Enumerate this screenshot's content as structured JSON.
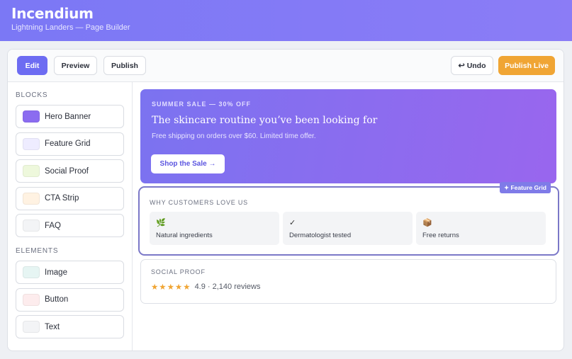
{
  "app": {
    "title": "Incendium",
    "subtitle": "Lightning Landers — Page Builder"
  },
  "toolbar": {
    "edit_label": "Edit",
    "preview_label": "Preview",
    "publish_label": "Publish",
    "undo_label": "Undo",
    "publish_live_label": "Publish Live"
  },
  "sidebar": {
    "blocks_title": "BLOCKS",
    "blocks": [
      {
        "label": "Hero Banner",
        "color": "#8b6cf0"
      },
      {
        "label": "Feature Grid",
        "color": "#eeecff"
      },
      {
        "label": "Social Proof",
        "color": "#eef8dc"
      },
      {
        "label": "CTA Strip",
        "color": "#fff2e2"
      },
      {
        "label": "FAQ",
        "color": "#f3f4f6"
      }
    ],
    "elements_title": "ELEMENTS",
    "elements": [
      {
        "label": "Image",
        "color": "#e6f5f3"
      },
      {
        "label": "Button",
        "color": "#fdeced"
      },
      {
        "label": "Text",
        "color": "#f3f4f6"
      }
    ]
  },
  "hero": {
    "eyebrow": "SUMMER SALE — 30% OFF",
    "title": "The skincare routine you’ve been looking for",
    "subtitle": "Free shipping on orders over $60. Limited time offer.",
    "button": "Shop the Sale →"
  },
  "feature_grid": {
    "tag": "✦ Feature Grid",
    "title": "WHY CUSTOMERS LOVE US",
    "cards": [
      {
        "icon": "🌿",
        "icon_name": "leaf-icon",
        "label": "Natural ingredients"
      },
      {
        "icon": "✓",
        "icon_name": "check-icon",
        "label": "Dermatologist tested"
      },
      {
        "icon": "📦",
        "icon_name": "package-icon",
        "label": "Free returns"
      }
    ]
  },
  "social_proof": {
    "title": "SOCIAL PROOF",
    "stars": "★★★★★",
    "rating_text": "4.9 · 2,140 reviews"
  },
  "colors": {
    "accent": "#6d6cf2",
    "publish_live": "#f0a534",
    "selection": "#7b78c8"
  }
}
